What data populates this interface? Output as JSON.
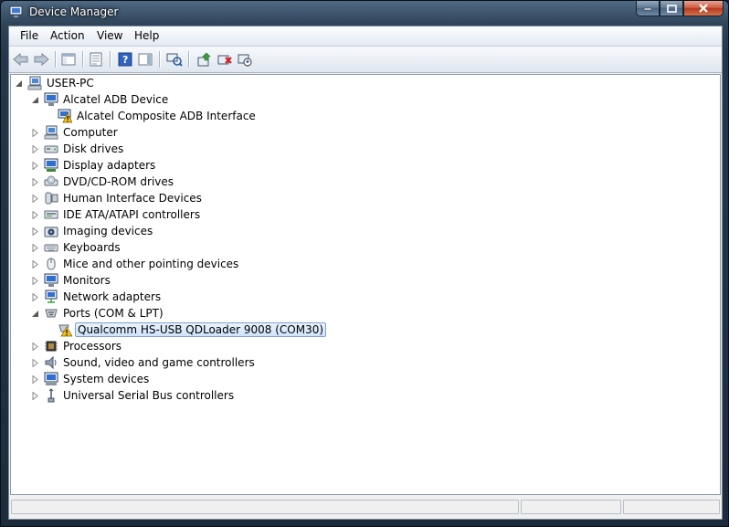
{
  "window": {
    "title": "Device Manager"
  },
  "menu": [
    "File",
    "Action",
    "View",
    "Help"
  ],
  "toolbar": {
    "buttons": [
      "back-icon",
      "forward-icon",
      "show-hide-console-tree-icon",
      "properties-icon",
      "help-icon",
      "action-pane-icon",
      "scan-hardware-icon",
      "update-driver-icon",
      "uninstall-icon",
      "disable-icon"
    ]
  },
  "tree": {
    "root": "USER-PC",
    "items": [
      {
        "label": "Alcatel ADB Device",
        "expander": "open",
        "icon": "monitor-icon"
      },
      {
        "label": "Alcatel Composite ADB Interface",
        "child": true,
        "icon": "warning-device-icon"
      },
      {
        "label": "Computer",
        "expander": "closed",
        "icon": "computer-icon"
      },
      {
        "label": "Disk drives",
        "expander": "closed",
        "icon": "disk-drive-icon"
      },
      {
        "label": "Display adapters",
        "expander": "closed",
        "icon": "display-adapter-icon"
      },
      {
        "label": "DVD/CD-ROM drives",
        "expander": "closed",
        "icon": "dvd-drive-icon"
      },
      {
        "label": "Human Interface Devices",
        "expander": "closed",
        "icon": "hid-icon"
      },
      {
        "label": "IDE ATA/ATAPI controllers",
        "expander": "closed",
        "icon": "ide-controller-icon"
      },
      {
        "label": "Imaging devices",
        "expander": "closed",
        "icon": "camera-icon"
      },
      {
        "label": "Keyboards",
        "expander": "closed",
        "icon": "keyboard-icon"
      },
      {
        "label": "Mice and other pointing devices",
        "expander": "closed",
        "icon": "mouse-icon"
      },
      {
        "label": "Monitors",
        "expander": "closed",
        "icon": "monitor-icon"
      },
      {
        "label": "Network adapters",
        "expander": "closed",
        "icon": "network-adapter-icon"
      },
      {
        "label": "Ports (COM & LPT)",
        "expander": "open",
        "icon": "port-icon"
      },
      {
        "label": "Qualcomm HS-USB QDLoader 9008 (COM30)",
        "child": true,
        "selected": true,
        "icon": "warning-port-icon"
      },
      {
        "label": "Processors",
        "expander": "closed",
        "icon": "processor-icon"
      },
      {
        "label": "Sound, video and game controllers",
        "expander": "closed",
        "icon": "speaker-icon"
      },
      {
        "label": "System devices",
        "expander": "closed",
        "icon": "system-devices-icon"
      },
      {
        "label": "Universal Serial Bus controllers",
        "expander": "closed",
        "icon": "usb-icon"
      }
    ]
  },
  "colors": {
    "selection": "#cfe3fb",
    "selection_border": "#7da2ce",
    "warning": "#f2c21b"
  }
}
